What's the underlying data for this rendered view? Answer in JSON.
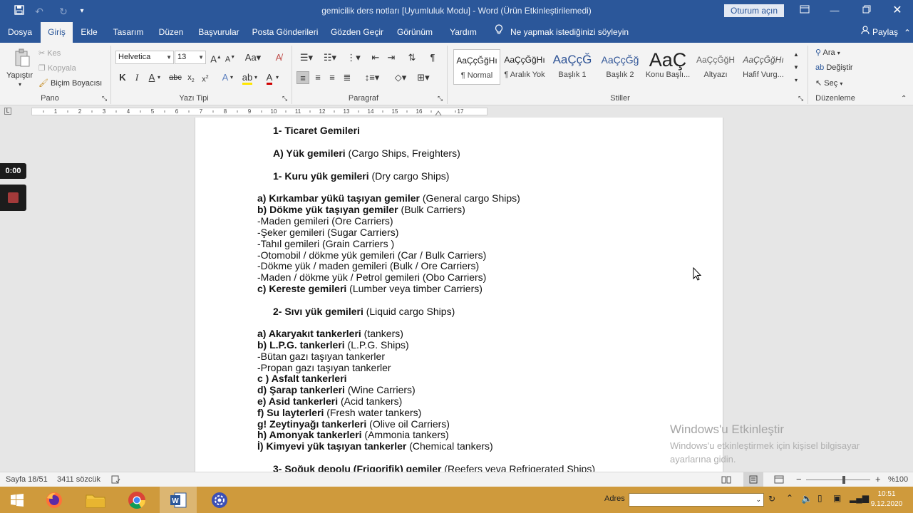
{
  "window": {
    "title": "gemicilik ders notları [Uyumluluk Modu]  -  Word (Ürün Etkinleştirilemedi)",
    "signin_label": "Oturum açın"
  },
  "tabs": [
    {
      "label": "Dosya"
    },
    {
      "label": "Giriş"
    },
    {
      "label": "Ekle"
    },
    {
      "label": "Tasarım"
    },
    {
      "label": "Düzen"
    },
    {
      "label": "Başvurular"
    },
    {
      "label": "Posta Gönderileri"
    },
    {
      "label": "Gözden Geçir"
    },
    {
      "label": "Görünüm"
    },
    {
      "label": "Yardım"
    }
  ],
  "tellme": "Ne yapmak istediğinizi söyleyin",
  "share": "Paylaş",
  "ribbon": {
    "clipboard": {
      "paste": "Yapıştır",
      "cut": "Kes",
      "copy": "Kopyala",
      "format_painter": "Biçim Boyacısı",
      "label": "Pano"
    },
    "font": {
      "family": "Helvetica",
      "size": "13",
      "label": "Yazı Tipi"
    },
    "paragraph": {
      "label": "Paragraf"
    },
    "styles": {
      "label": "Stiller",
      "items": [
        {
          "preview": "AaÇçĞğHı",
          "name": "¶ Normal"
        },
        {
          "preview": "AaÇçĞğHı",
          "name": "¶ Aralık Yok"
        },
        {
          "preview": "AaÇçĞ",
          "name": "Başlık 1"
        },
        {
          "preview": "AaÇçĞğ",
          "name": "Başlık 2"
        },
        {
          "preview": "AaÇ",
          "name": "Konu Başlı..."
        },
        {
          "preview": "AaÇçĞğH",
          "name": "Altyazı"
        },
        {
          "preview": "AaÇçĞğHı",
          "name": "Hafif Vurg..."
        }
      ]
    },
    "editing": {
      "find": "Ara",
      "replace": "Değiştir",
      "select": "Seç",
      "label": "Düzenleme"
    }
  },
  "document": {
    "lines": [
      {
        "b": "1-   Ticaret Gemileri",
        "n": ""
      },
      {
        "b": "A)  Yük gemileri",
        "n": " (Cargo Ships, Freighters)"
      },
      {
        "b": "1-   Kuru yük gemileri",
        "n": " (Dry cargo Ships)"
      },
      {
        "b": "a) Kırkambar yükü taşıyan gemiler",
        "n": " (General cargo Ships)"
      },
      {
        "b": "b) Dökme yük taşıyan gemiler",
        "n": " (Bulk Carriers)"
      },
      {
        "b": "",
        "n": "-Maden gemileri (Ore Carriers)"
      },
      {
        "b": "",
        "n": "-Şeker gemileri (Sugar Carriers)"
      },
      {
        "b": "",
        "n": "-Tahıl gemileri (Grain Carriers )"
      },
      {
        "b": "",
        "n": "-Otomobil / dökme yük gemileri (Car / Bulk Carriers)"
      },
      {
        "b": "",
        "n": "-Dökme yük / maden gemileri (Bulk / Ore Carriers)"
      },
      {
        "b": "",
        "n": "-Maden / dökme yük / Petrol gemileri (Obo Carriers)"
      },
      {
        "b": "c) Kereste gemileri",
        "n": " (Lumber veya timber Carriers)"
      },
      {
        "b": "2-   Sıvı yük gemileri",
        "n": " (Liquid cargo Ships)"
      },
      {
        "b": "a) Akaryakıt tankerleri",
        "n": " (tankers)"
      },
      {
        "b": "b) L.P.G. tankerleri",
        "n": " (L.P.G. Ships)"
      },
      {
        "b": "",
        "n": "-Bütan gazı taşıyan tankerler"
      },
      {
        "b": "",
        "n": "-Propan gazı taşıyan tankerler"
      },
      {
        "b": "c ) Asfalt tankerleri",
        "n": ""
      },
      {
        "b": "d) Şarap tankerleri",
        "n": " (Wine Carriers)"
      },
      {
        "b": "e) Asid tankerleri",
        "n": " (Acid tankers)"
      },
      {
        "b": "f) Su layterleri",
        "n": " (Fresh water tankers)"
      },
      {
        "b": "g! Zeytinyağı tankerleri",
        "n": " (Olive oil Carriers)"
      },
      {
        "b": "h) Amonyak tankerleri",
        "n": " (Ammonia tankers)"
      },
      {
        "b": "İ) Kimyevi yük taşıyan tankerler",
        "n": " (Chemical tankers)"
      },
      {
        "b": "3-   Soğuk depolu (Frigorifik) gemiler",
        "n": " (Reefers veya Refrigerated Ships)"
      }
    ]
  },
  "recorder": {
    "time": "0:00"
  },
  "watermark": {
    "title": "Windows'u Etkinleştir",
    "text": "Windows'u etkinleştirmek için kişisel bilgisayar ayarlarına gidin."
  },
  "status": {
    "page": "Sayfa 18/51",
    "words": "3411 sözcük",
    "zoom": "%100",
    "zoom_level": 100
  },
  "taskbar": {
    "address_label": "Adres",
    "time": "10:51",
    "date": "9.12.2020"
  },
  "colors": {
    "word_blue": "#2b579a",
    "taskbar": "#cf9a3c",
    "squiggle": "#d13438"
  }
}
